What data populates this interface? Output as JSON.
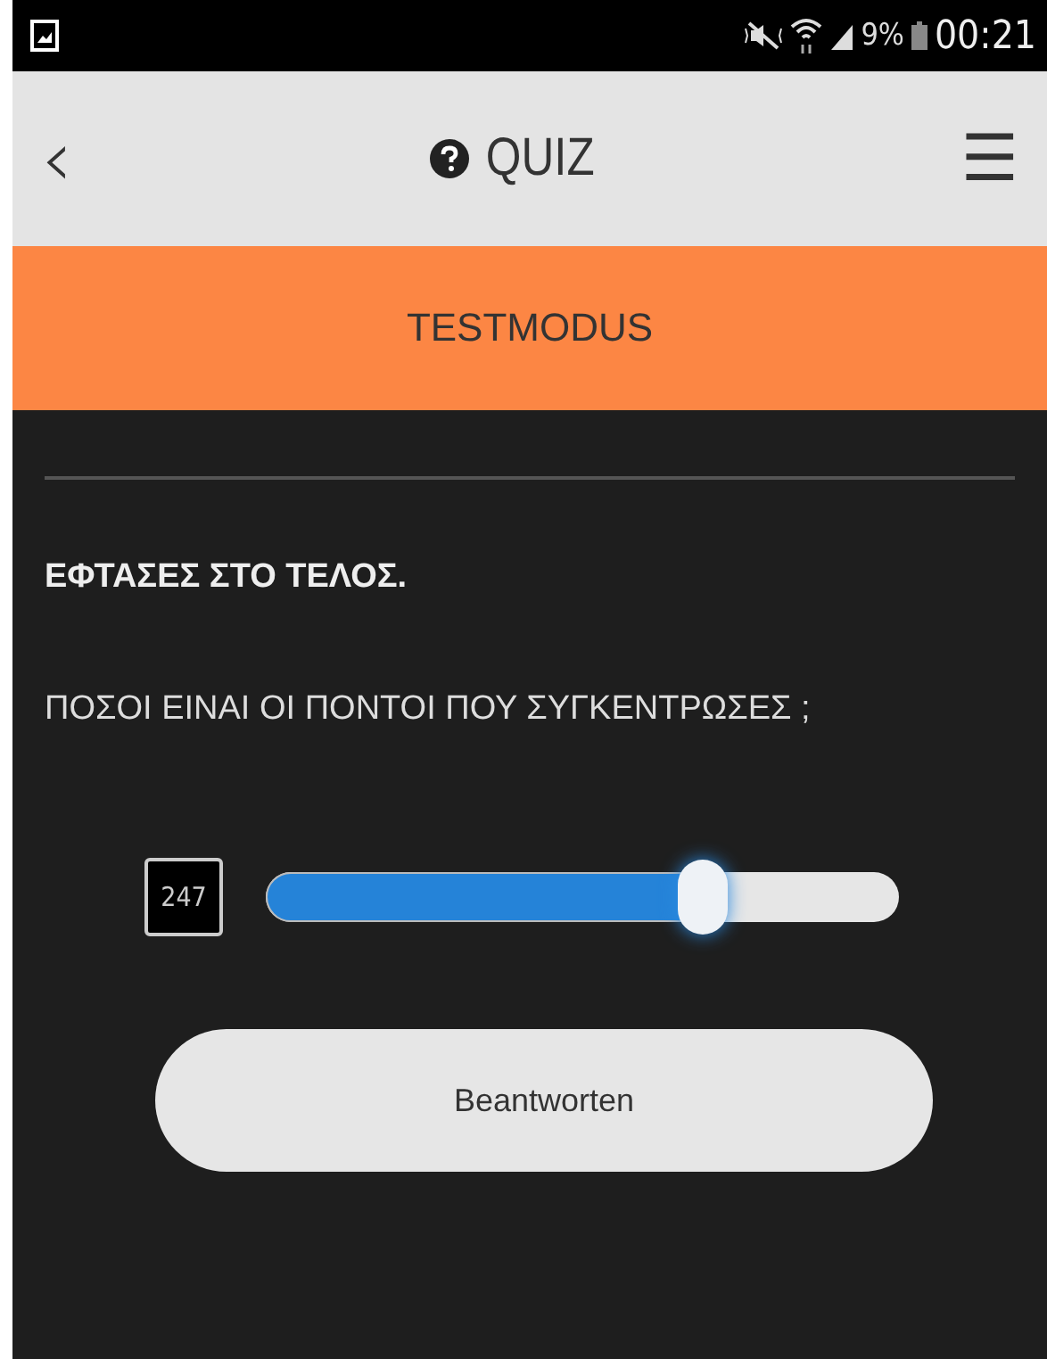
{
  "status_bar": {
    "battery_text": "9%",
    "time": "00:21"
  },
  "header": {
    "back": "‹",
    "title": "QUIZ",
    "menu": "☰"
  },
  "mode_bar": {
    "label": "TESTMODUS"
  },
  "texts": [
    "ΕΦΤΑΣΕΣ ΣΤΟ ΤΕΛΟΣ.",
    "ΠΟΣΟΙ ΕΙΝΑΙ ΟΙ ΠΟΝΤΟΙ ΠΟΥ ΣΥΓΚΕΝΤΡΩΣΕΣ ;"
  ],
  "slider": {
    "value": "247",
    "level": 0.69
  },
  "button": {
    "label": "Beantworten"
  }
}
